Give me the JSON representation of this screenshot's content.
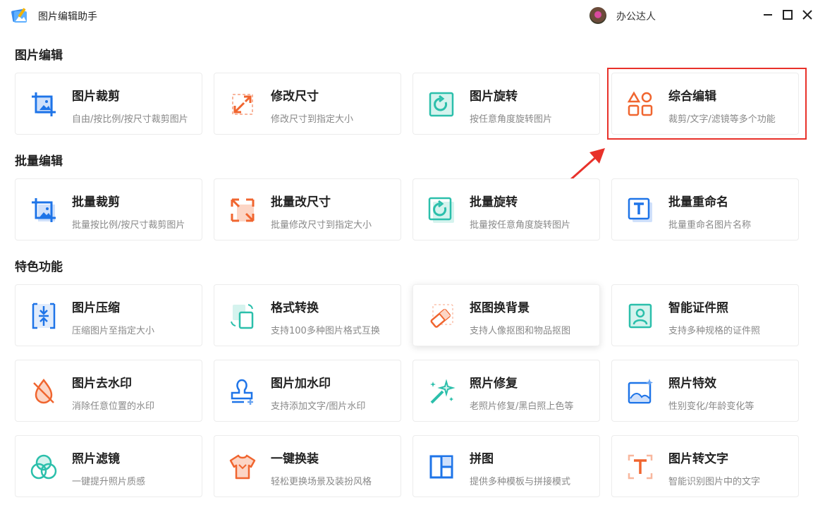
{
  "titlebar": {
    "app_title": "图片编辑助手",
    "user_name": "办公达人"
  },
  "sections": [
    {
      "title": "图片编辑",
      "cards": [
        {
          "title": "图片裁剪",
          "desc": "自由/按比例/按尺寸裁剪图片",
          "icon": "crop-icon"
        },
        {
          "title": "修改尺寸",
          "desc": "修改尺寸到指定大小",
          "icon": "resize-icon"
        },
        {
          "title": "图片旋转",
          "desc": "按任意角度旋转图片",
          "icon": "rotate-icon"
        },
        {
          "title": "综合编辑",
          "desc": "裁剪/文字/滤镜等多个功能",
          "icon": "shapes-icon"
        }
      ]
    },
    {
      "title": "批量编辑",
      "cards": [
        {
          "title": "批量裁剪",
          "desc": "批量按比例/按尺寸裁剪图片",
          "icon": "batch-crop-icon"
        },
        {
          "title": "批量改尺寸",
          "desc": "批量修改尺寸到指定大小",
          "icon": "batch-resize-icon"
        },
        {
          "title": "批量旋转",
          "desc": "批量按任意角度旋转图片",
          "icon": "batch-rotate-icon"
        },
        {
          "title": "批量重命名",
          "desc": "批量重命名图片名称",
          "icon": "rename-icon"
        }
      ]
    },
    {
      "title": "特色功能",
      "cards": [
        {
          "title": "图片压缩",
          "desc": "压缩图片至指定大小",
          "icon": "compress-icon"
        },
        {
          "title": "格式转换",
          "desc": "支持100多种图片格式互换",
          "icon": "format-convert-icon"
        },
        {
          "title": "抠图换背景",
          "desc": "支持人像抠图和物品抠图",
          "icon": "eraser-icon"
        },
        {
          "title": "智能证件照",
          "desc": "支持多种规格的证件照",
          "icon": "id-photo-icon"
        },
        {
          "title": "图片去水印",
          "desc": "消除任意位置的水印",
          "icon": "no-watermark-icon"
        },
        {
          "title": "图片加水印",
          "desc": "支持添加文字/图片水印",
          "icon": "stamp-icon"
        },
        {
          "title": "照片修复",
          "desc": "老照片修复/黑白照上色等",
          "icon": "magic-wand-icon"
        },
        {
          "title": "照片特效",
          "desc": "性别变化/年龄变化等",
          "icon": "image-effect-icon"
        },
        {
          "title": "照片滤镜",
          "desc": "一键提升照片质感",
          "icon": "filter-icon"
        },
        {
          "title": "一键换装",
          "desc": "轻松更换场景及装扮风格",
          "icon": "shirt-icon"
        },
        {
          "title": "拼图",
          "desc": "提供多种模板与拼接模式",
          "icon": "collage-icon"
        },
        {
          "title": "图片转文字",
          "desc": "智能识别图片中的文字",
          "icon": "ocr-icon"
        }
      ]
    }
  ],
  "colors": {
    "blue": "#1e74e8",
    "orange": "#f0652f",
    "teal": "#2bbfab",
    "highlight": "#e8312a"
  }
}
